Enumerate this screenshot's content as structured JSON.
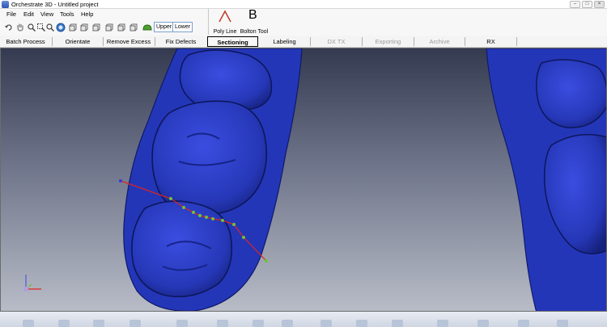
{
  "window": {
    "title": "Orchestrate 3D - Untitled project"
  },
  "menu": {
    "items": [
      "File",
      "Edit",
      "View",
      "Tools",
      "Help"
    ]
  },
  "toolbar": {
    "upper_label": "Upper",
    "lower_label": "Lower"
  },
  "tools": {
    "polyline": {
      "label": "Poly Line",
      "glyph": "Λ"
    },
    "bolton": {
      "label": "Bolton Tool",
      "glyph": "B"
    }
  },
  "tabs": [
    {
      "label": "Batch Process",
      "state": "normal"
    },
    {
      "label": "Orientate",
      "state": "normal"
    },
    {
      "label": "Remove Excess",
      "state": "normal"
    },
    {
      "label": "Fix Defects",
      "state": "normal"
    },
    {
      "label": "Sectioning",
      "state": "active"
    },
    {
      "label": "Labeling",
      "state": "normal"
    },
    {
      "label": "DX TX",
      "state": "disabled"
    },
    {
      "label": "Exporting",
      "state": "disabled"
    },
    {
      "label": "Archive",
      "state": "disabled"
    },
    {
      "label": "RX",
      "state": "normal"
    }
  ],
  "colors": {
    "model": "#2b3bbf",
    "polyline": "#e0231e",
    "points": "#6dc23a",
    "accent": "#2c55b0"
  }
}
